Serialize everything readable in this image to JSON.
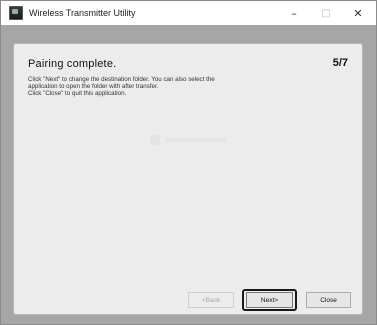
{
  "window": {
    "title": "Wireless Transmitter Utility",
    "controls": {
      "minimize": "–",
      "maximize": "□",
      "close": "✕"
    }
  },
  "panel": {
    "heading": "Pairing complete.",
    "step": "5/7",
    "body_lines": [
      "Click \"Next\" to change the destination folder. You can also select the",
      "application to open the folder with after transfer.",
      "Click \"Close\" to quit this application."
    ]
  },
  "buttons": {
    "back": "<Back",
    "next": "Next>",
    "close": "Close"
  }
}
